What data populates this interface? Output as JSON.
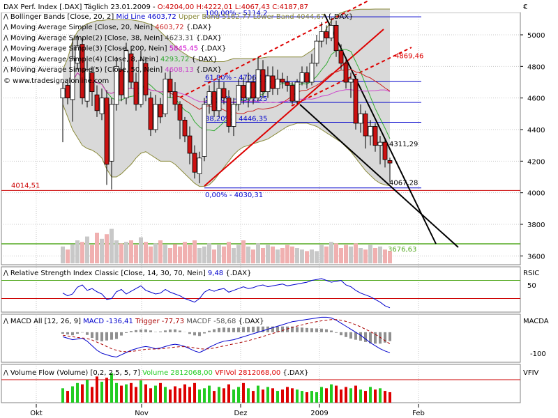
{
  "colors": {
    "up": "#ffffff",
    "down": "#cc1111",
    "band_fill": "#d9d9d9",
    "band_line": "#8a8a3a",
    "mid_line": "#555555",
    "ma20": "#cc2222",
    "ma38": "#444444",
    "ma200": "#cc00cc",
    "ma8": "#33aa33",
    "ma50": "#cc44cc",
    "fib": "#0000cc",
    "channel": "#dd0000",
    "support": "#55aa22",
    "rsi": "#0000cc",
    "ref": "#cc0000",
    "macd": "#0000cc",
    "trigger": "#aa0000",
    "vol_up": "#22cc22",
    "vol_down": "#dd0000",
    "grid": "#c8c8c8"
  },
  "header": {
    "title_line": "DAX Perf. Index [.DAX] Täglich 23.01.2009 - ",
    "ohlc": "O:4204,00 H:4222,01 L:4067,43 C:4187,87",
    "euro": "€",
    "copyright": "© www.tradesignalonline.com"
  },
  "legend": [
    {
      "label": "Bollinger Bands [Close, 20, 2]",
      "parts": [
        {
          "text": "Mid Line 4603,72",
          "color": "#0000cc"
        },
        {
          "text": "Upper Band 5162,77",
          "color": "#8a8a3a"
        },
        {
          "text": "Lower Band 4044,67",
          "color": "#8a8a3a"
        },
        {
          "text": "{.DAX}",
          "color": "#000000"
        }
      ]
    },
    {
      "label": "Moving Average Simple [Close, 20, Nein]",
      "parts": [
        {
          "text": "4603,72",
          "color": "#cc2222"
        },
        {
          "text": "{.DAX}",
          "color": "#000000"
        }
      ]
    },
    {
      "label": "Moving Average Simple(2) [Close, 38, Nein]",
      "parts": [
        {
          "text": "4623,31",
          "color": "#444444"
        },
        {
          "text": "{.DAX}",
          "color": "#000000"
        }
      ]
    },
    {
      "label": "Moving Average Simple(3) [Close, 200, Nein]",
      "parts": [
        {
          "text": "5845,45",
          "color": "#cc00cc"
        },
        {
          "text": "{.DAX}",
          "color": "#000000"
        }
      ]
    },
    {
      "label": "Moving Average Simple(4) [Close, 8, Nein]",
      "parts": [
        {
          "text": "4293,72",
          "color": "#33aa33"
        },
        {
          "text": "{.DAX}",
          "color": "#000000"
        }
      ]
    },
    {
      "label": "Moving Average Simple(5) [Close, 50, Nein]",
      "parts": [
        {
          "text": "4608,13",
          "color": "#cc44cc"
        },
        {
          "text": "{.DAX}",
          "color": "#000000"
        }
      ]
    }
  ],
  "chart_data": [
    {
      "type": "candlestick",
      "title": "DAX Perf. Index [.DAX] Täglich",
      "ylim": [
        3600,
        5200
      ],
      "yticks": [
        "5000",
        "4800",
        "4600",
        "4400",
        "4200",
        "4000",
        "3800",
        "3600"
      ],
      "x_labels": [
        "Okt",
        "Nov",
        "Dez",
        "2009",
        "Feb"
      ],
      "candles": [
        {
          "o": 4600,
          "c": 4660,
          "h": 4700,
          "l": 4320
        },
        {
          "o": 4680,
          "c": 4600,
          "h": 4720,
          "l": 4560
        },
        {
          "o": 4590,
          "c": 4850,
          "h": 4980,
          "l": 4450
        },
        {
          "o": 4820,
          "c": 4930,
          "h": 5000,
          "l": 4780
        },
        {
          "o": 4940,
          "c": 4600,
          "h": 4980,
          "l": 4560
        },
        {
          "o": 4580,
          "c": 4780,
          "h": 4850,
          "l": 4540
        },
        {
          "o": 4760,
          "c": 4640,
          "h": 4800,
          "l": 4550
        },
        {
          "o": 4620,
          "c": 4520,
          "h": 4680,
          "l": 4480
        },
        {
          "o": 4500,
          "c": 4600,
          "h": 4660,
          "l": 4460
        },
        {
          "o": 4600,
          "c": 4180,
          "h": 4650,
          "l": 4050
        },
        {
          "o": 4200,
          "c": 4560,
          "h": 4600,
          "l": 4020
        },
        {
          "o": 4560,
          "c": 4800,
          "h": 4860,
          "l": 4520
        },
        {
          "o": 4780,
          "c": 4620,
          "h": 4830,
          "l": 4580
        },
        {
          "o": 4600,
          "c": 4900,
          "h": 4950,
          "l": 4560
        },
        {
          "o": 4880,
          "c": 4700,
          "h": 4930,
          "l": 4660
        },
        {
          "o": 4700,
          "c": 4560,
          "h": 4760,
          "l": 4520
        },
        {
          "o": 4560,
          "c": 4840,
          "h": 4900,
          "l": 4540
        },
        {
          "o": 4820,
          "c": 4620,
          "h": 4860,
          "l": 4580
        },
        {
          "o": 4600,
          "c": 4400,
          "h": 4640,
          "l": 4360
        },
        {
          "o": 4400,
          "c": 4560,
          "h": 4620,
          "l": 4380
        },
        {
          "o": 4560,
          "c": 4480,
          "h": 4600,
          "l": 4440
        },
        {
          "o": 4500,
          "c": 4720,
          "h": 4760,
          "l": 4480
        },
        {
          "o": 4720,
          "c": 4640,
          "h": 4780,
          "l": 4600
        },
        {
          "o": 4640,
          "c": 4560,
          "h": 4700,
          "l": 4520
        },
        {
          "o": 4560,
          "c": 4460,
          "h": 4580,
          "l": 4340
        },
        {
          "o": 4460,
          "c": 4360,
          "h": 4480,
          "l": 4320
        },
        {
          "o": 4360,
          "c": 4250,
          "h": 4420,
          "l": 4180
        },
        {
          "o": 4250,
          "c": 4130,
          "h": 4300,
          "l": 4090
        },
        {
          "o": 4120,
          "c": 4220,
          "h": 4260,
          "l": 4060
        },
        {
          "o": 4230,
          "c": 4560,
          "h": 4600,
          "l": 4200
        },
        {
          "o": 4560,
          "c": 4640,
          "h": 4680,
          "l": 4500
        },
        {
          "o": 4640,
          "c": 4520,
          "h": 4700,
          "l": 4480
        },
        {
          "o": 4520,
          "c": 4660,
          "h": 4720,
          "l": 4480
        },
        {
          "o": 4660,
          "c": 4600,
          "h": 4700,
          "l": 4560
        },
        {
          "o": 4600,
          "c": 4420,
          "h": 4650,
          "l": 4380
        },
        {
          "o": 4420,
          "c": 4560,
          "h": 4600,
          "l": 4360
        },
        {
          "o": 4560,
          "c": 4680,
          "h": 4720,
          "l": 4520
        },
        {
          "o": 4680,
          "c": 4600,
          "h": 4730,
          "l": 4560
        },
        {
          "o": 4600,
          "c": 4700,
          "h": 4760,
          "l": 4540
        },
        {
          "o": 4700,
          "c": 4600,
          "h": 4740,
          "l": 4560
        },
        {
          "o": 4600,
          "c": 4780,
          "h": 4860,
          "l": 4580
        },
        {
          "o": 4780,
          "c": 4640,
          "h": 4840,
          "l": 4600
        },
        {
          "o": 4640,
          "c": 4740,
          "h": 4800,
          "l": 4600
        },
        {
          "o": 4740,
          "c": 4660,
          "h": 4800,
          "l": 4620
        },
        {
          "o": 4660,
          "c": 4720,
          "h": 4780,
          "l": 4620
        },
        {
          "o": 4720,
          "c": 4700,
          "h": 4760,
          "l": 4660
        },
        {
          "o": 4700,
          "c": 4680,
          "h": 4740,
          "l": 4640
        },
        {
          "o": 4680,
          "c": 4580,
          "h": 4700,
          "l": 4560
        },
        {
          "o": 4580,
          "c": 4700,
          "h": 4720,
          "l": 4560
        },
        {
          "o": 4700,
          "c": 4760,
          "h": 4800,
          "l": 4680
        },
        {
          "o": 4760,
          "c": 4700,
          "h": 4800,
          "l": 4660
        },
        {
          "o": 4700,
          "c": 4820,
          "h": 4880,
          "l": 4680
        },
        {
          "o": 4820,
          "c": 4960,
          "h": 5000,
          "l": 4800
        },
        {
          "o": 4960,
          "c": 5020,
          "h": 5080,
          "l": 4920
        },
        {
          "o": 5020,
          "c": 4980,
          "h": 5060,
          "l": 4940
        },
        {
          "o": 4980,
          "c": 5060,
          "h": 5110,
          "l": 4960
        },
        {
          "o": 5060,
          "c": 4900,
          "h": 5090,
          "l": 4860
        },
        {
          "o": 4900,
          "c": 4820,
          "h": 4940,
          "l": 4780
        },
        {
          "o": 4820,
          "c": 4700,
          "h": 4860,
          "l": 4660
        },
        {
          "o": 4700,
          "c": 4720,
          "h": 4760,
          "l": 4600
        },
        {
          "o": 4720,
          "c": 4440,
          "h": 4740,
          "l": 4400
        },
        {
          "o": 4440,
          "c": 4500,
          "h": 4560,
          "l": 4380
        },
        {
          "o": 4500,
          "c": 4360,
          "h": 4520,
          "l": 4280
        },
        {
          "o": 4360,
          "c": 4420,
          "h": 4460,
          "l": 4300
        },
        {
          "o": 4420,
          "c": 4300,
          "h": 4440,
          "l": 4260
        },
        {
          "o": 4300,
          "c": 4320,
          "h": 4360,
          "l": 4180
        },
        {
          "o": 4320,
          "c": 4210,
          "h": 4340,
          "l": 4160
        },
        {
          "o": 4204,
          "c": 4188,
          "h": 4222,
          "l": 4067
        }
      ],
      "bollinger": {
        "upper": [
          4780,
          4850,
          4960,
          5020,
          5050,
          5070,
          5080,
          5090,
          5090,
          5095,
          5095,
          5095,
          5095,
          5095,
          5095,
          5090,
          5085,
          5075,
          5065,
          5050,
          5020,
          4990,
          4960,
          4930,
          4900,
          4880,
          4860,
          4850,
          4840,
          4830,
          4830,
          4830,
          4830,
          4830,
          4840,
          4850,
          4850,
          4850,
          4850,
          4850,
          4850,
          4855,
          4860,
          4860,
          4860,
          4860,
          4860,
          4860,
          4860,
          4860,
          4880,
          4900,
          4930,
          4980,
          5040,
          5090,
          5120,
          5140,
          5150,
          5155,
          5160,
          5162,
          5162,
          5162,
          5163,
          5163,
          5163,
          5163
        ],
        "lower": [
          4560,
          4480,
          4400,
          4350,
          4300,
          4280,
          4270,
          4250,
          4220,
          4150,
          4100,
          4100,
          4120,
          4150,
          4180,
          4220,
          4250,
          4260,
          4240,
          4220,
          4200,
          4200,
          4200,
          4180,
          4150,
          4120,
          4090,
          4060,
          4040,
          4040,
          4050,
          4080,
          4120,
          4160,
          4200,
          4240,
          4270,
          4290,
          4300,
          4310,
          4320,
          4330,
          4340,
          4360,
          4380,
          4400,
          4420,
          4430,
          4440,
          4440,
          4440,
          4430,
          4420,
          4400,
          4380,
          4360,
          4340,
          4320,
          4290,
          4260,
          4220,
          4180,
          4140,
          4110,
          4080,
          4060,
          4050,
          4045
        ]
      },
      "horizontal_lines": [
        {
          "value": 4014.51,
          "label": "4014,51"
        },
        {
          "value": 3676.63,
          "label": "3676,63"
        }
      ],
      "fibonacci": [
        {
          "value": 5114.2,
          "label": "100,00% - 5114,2"
        },
        {
          "value": 4706.15,
          "label": "61,80% - 4706,15"
        },
        {
          "value": 4572.25,
          "label": "50,00% - 4572,25"
        },
        {
          "value": 4446.35,
          "label": "38,20% - 4446,35"
        },
        {
          "value": 4030.31,
          "label": "0,00% - 4030,31"
        }
      ],
      "price_labels": [
        {
          "value": 4869.46,
          "text": "4869,46"
        },
        {
          "value": 4311.29,
          "text": "4311,29"
        },
        {
          "value": 4067.28,
          "text": "4067,28"
        }
      ],
      "volume": [
        22,
        18,
        25,
        30,
        28,
        35,
        24,
        40,
        32,
        38,
        45,
        30,
        26,
        28,
        30,
        24,
        34,
        28,
        22,
        26,
        30,
        24,
        20,
        25,
        22,
        28,
        24,
        30,
        20,
        22,
        26,
        18,
        24,
        22,
        28,
        20,
        24,
        30,
        22,
        18,
        26,
        20,
        24,
        22,
        18,
        20,
        24,
        22,
        20,
        18,
        16,
        18,
        16,
        24,
        22,
        28,
        26,
        20,
        24,
        22,
        26,
        20,
        18,
        24,
        20,
        22,
        18,
        16
      ]
    },
    {
      "type": "line",
      "title": "Relative Strength Index Classic [Close, 14, 30, 70, Nein]",
      "current_value": "9,48",
      "symbol": "{.DAX}",
      "ylabel": "RSIC",
      "ytick": "50",
      "levels": [
        30,
        70
      ],
      "values": [
        42,
        36,
        40,
        55,
        60,
        48,
        52,
        45,
        40,
        28,
        30,
        45,
        50,
        40,
        46,
        52,
        58,
        48,
        44,
        40,
        42,
        50,
        44,
        40,
        36,
        30,
        26,
        22,
        30,
        44,
        50,
        46,
        50,
        52,
        44,
        48,
        52,
        56,
        52,
        54,
        58,
        60,
        56,
        58,
        60,
        62,
        58,
        60,
        62,
        64,
        66,
        70,
        72,
        74,
        70,
        66,
        68,
        70,
        60,
        56,
        48,
        42,
        38,
        34,
        28,
        22,
        14,
        9.48
      ]
    },
    {
      "type": "bar+line",
      "title": "MACD All [12, 26, 9]",
      "macd_label": "MACD -136,41",
      "trigger_label": "Trigger -77,73",
      "macdf_label": "MACDF -58,68",
      "symbol": "{.DAX}",
      "ylabel": "MACDA",
      "ytick": "-100",
      "macd": [
        -30,
        -40,
        -50,
        -45,
        -40,
        -60,
        -90,
        -120,
        -140,
        -150,
        -160,
        -165,
        -150,
        -135,
        -120,
        -110,
        -100,
        -95,
        -100,
        -110,
        -105,
        -95,
        -85,
        -80,
        -85,
        -95,
        -110,
        -125,
        -135,
        -120,
        -100,
        -85,
        -70,
        -60,
        -55,
        -50,
        -40,
        -30,
        -20,
        -10,
        0,
        10,
        20,
        30,
        40,
        50,
        60,
        70,
        75,
        80,
        85,
        90,
        95,
        100,
        100,
        95,
        80,
        60,
        40,
        20,
        0,
        -20,
        -45,
        -70,
        -90,
        -110,
        -125,
        -136.41
      ],
      "trigger": [
        -20,
        -25,
        -30,
        -35,
        -38,
        -42,
        -52,
        -66,
        -80,
        -95,
        -110,
        -120,
        -128,
        -130,
        -128,
        -124,
        -118,
        -114,
        -112,
        -112,
        -110,
        -107,
        -103,
        -99,
        -96,
        -96,
        -99,
        -104,
        -110,
        -112,
        -110,
        -105,
        -98,
        -91,
        -84,
        -78,
        -71,
        -64,
        -56,
        -47,
        -38,
        -28,
        -18,
        -8,
        2,
        12,
        22,
        32,
        41,
        49,
        57,
        64,
        70,
        76,
        80,
        84,
        84,
        80,
        72,
        62,
        50,
        36,
        20,
        4,
        -14,
        -34,
        -56,
        -77.73
      ]
    },
    {
      "type": "bar",
      "title": "Volume Flow (Volume) [0,2, 2,5, 5, 7]",
      "volume_label": "Volume 2812068,00",
      "vfivol_label": "VFIVol 2812068,00",
      "symbol": "{.DAX}",
      "ylabel": "VFIV",
      "values": [
        22,
        18,
        25,
        30,
        28,
        35,
        24,
        40,
        32,
        38,
        45,
        30,
        26,
        28,
        30,
        24,
        34,
        28,
        22,
        26,
        30,
        24,
        20,
        25,
        22,
        28,
        24,
        30,
        20,
        22,
        26,
        18,
        24,
        22,
        28,
        20,
        24,
        30,
        22,
        18,
        26,
        20,
        24,
        22,
        18,
        20,
        24,
        22,
        20,
        18,
        16,
        18,
        16,
        24,
        22,
        28,
        26,
        20,
        24,
        22,
        26,
        20,
        18,
        24,
        20,
        22,
        18,
        16
      ]
    }
  ]
}
